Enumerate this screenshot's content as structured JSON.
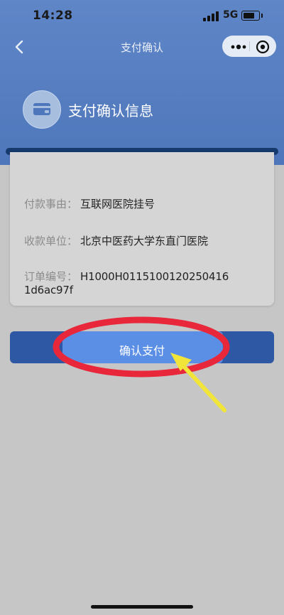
{
  "status_bar": {
    "time": "14:28",
    "network": "5G"
  },
  "nav": {
    "title": "支付确认"
  },
  "header": {
    "title": "支付确认信息"
  },
  "details": [
    {
      "label": "付款事由：",
      "value": "互联网医院挂号"
    },
    {
      "label": "收款单位：",
      "value": "北京中医药大学东直门医院"
    },
    {
      "label": "订单编号：",
      "value": "H1000H0115100120250416 1d6ac97f"
    }
  ],
  "confirm_button": {
    "label": "确认支付"
  },
  "icons": [
    "back-icon",
    "more-icon",
    "close-circle-icon",
    "card-icon"
  ],
  "colors": {
    "header": "#4e77bb",
    "button": "#2e58a3",
    "highlight": "#e8283a",
    "arrow": "#f2e53a"
  }
}
